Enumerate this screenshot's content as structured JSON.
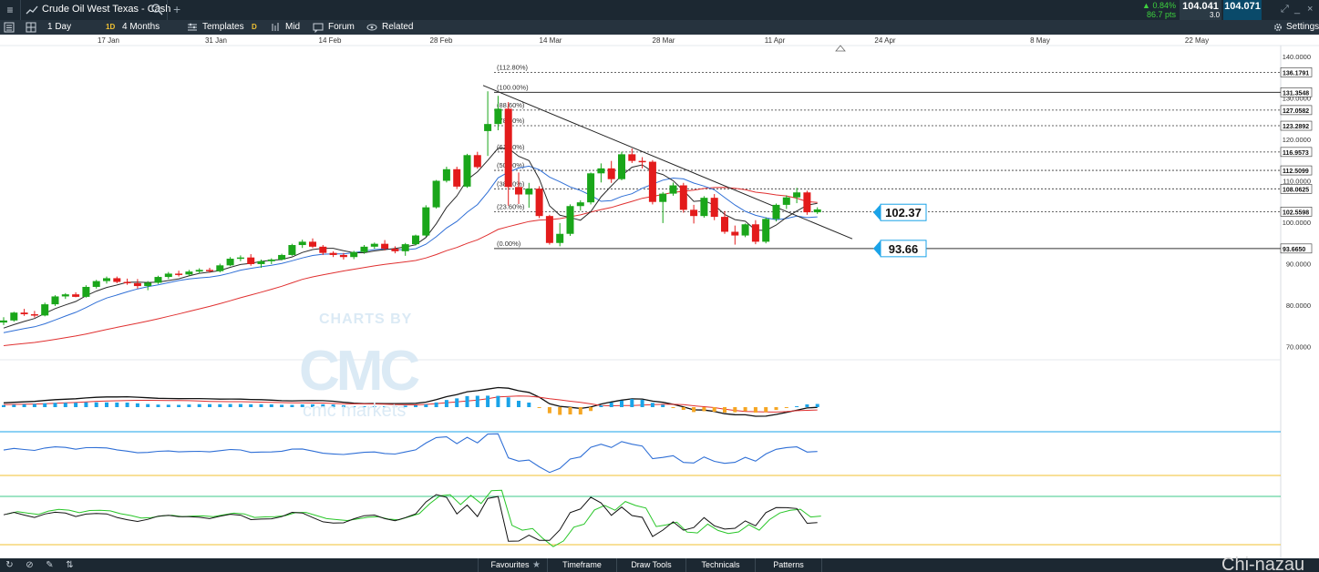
{
  "titlebar": {
    "instrument": "Crude Oil West Texas - Cash",
    "change_pct": "0.84%",
    "change_pts": "86.7 pts",
    "bid": "104.041",
    "spread": "3.0",
    "ask": "104.071"
  },
  "toolbar": {
    "interval": "1 Day",
    "badge_1d": "1D",
    "range": "4 Months",
    "templates": "Templates",
    "badge_d": "D",
    "price_type": "Mid",
    "forum": "Forum",
    "related": "Related",
    "settings": "Settings"
  },
  "watermark": {
    "line1": "CHARTS BY",
    "line2": "CMC",
    "line3": "cmc markets"
  },
  "bottombar": {
    "tabs": [
      "Favourites",
      "Timeframe",
      "Draw Tools",
      "Technicals",
      "Patterns"
    ],
    "corner_text": "Chi-nazau"
  },
  "colors": {
    "up": "#1aa61a",
    "down": "#e31b1b",
    "ma_short": "#2b2b2b",
    "ma_mid": "#2f6fd6",
    "ma_long": "#e03030",
    "accent": "#1aa3e8"
  },
  "chart_data": {
    "type": "candlestick",
    "x_axis_labels": [
      "17 Jan",
      "31 Jan",
      "14 Feb",
      "28 Feb",
      "14 Mar",
      "28 Mar",
      "11 Apr",
      "24 Apr",
      "8 May",
      "22 May"
    ],
    "y_axis_labels": [
      "140.0000",
      "130.0000",
      "120.0000",
      "110.0000",
      "100.0000",
      "90.0000",
      "80.0000",
      "70.0000"
    ],
    "ylim": [
      62,
      146
    ],
    "fib_levels": [
      {
        "label": "(112.80%)",
        "value": 136.1791,
        "axis_label": "136.1791"
      },
      {
        "label": "(100.00%)",
        "value": 131.3548,
        "axis_label": "131.3548"
      },
      {
        "label": "(88.60%)",
        "value": 127.0582,
        "axis_label": "127.0582"
      },
      {
        "label": "(78.60%)",
        "value": 123.2892,
        "axis_label": "123.2892"
      },
      {
        "label": "(61.80%)",
        "value": 116.9573,
        "axis_label": "116.9573"
      },
      {
        "label": "(50.00%)",
        "value": 112.5099,
        "axis_label": "112.5099"
      },
      {
        "label": "(38.20%)",
        "value": 108.0625,
        "axis_label": "108.0625"
      },
      {
        "label": "(23.60%)",
        "value": 102.5598,
        "axis_label": "102.5598"
      },
      {
        "label": "(0.00%)",
        "value": 93.665,
        "axis_label": "93.6650"
      }
    ],
    "callouts": [
      {
        "text": "102.37",
        "value": 102.37
      },
      {
        "text": "93.66",
        "value": 93.66
      }
    ],
    "candles": [
      [
        75.8,
        77.1,
        75.2,
        76.3
      ],
      [
        76.3,
        78.4,
        76.0,
        78.2
      ],
      [
        78.2,
        79.1,
        77.4,
        77.8
      ],
      [
        77.8,
        78.6,
        77.0,
        77.5
      ],
      [
        77.5,
        80.6,
        77.3,
        80.2
      ],
      [
        80.2,
        82.4,
        79.8,
        82.1
      ],
      [
        82.1,
        82.9,
        81.5,
        82.6
      ],
      [
        82.6,
        83.1,
        81.9,
        82.0
      ],
      [
        82.0,
        84.8,
        81.8,
        84.4
      ],
      [
        84.4,
        86.1,
        84.0,
        85.8
      ],
      [
        85.8,
        86.9,
        85.2,
        86.5
      ],
      [
        86.5,
        86.9,
        85.3,
        85.6
      ],
      [
        85.6,
        86.4,
        84.9,
        85.3
      ],
      [
        85.3,
        86.3,
        84.0,
        84.6
      ],
      [
        84.6,
        85.8,
        83.6,
        85.4
      ],
      [
        85.4,
        87.1,
        85.1,
        86.8
      ],
      [
        86.8,
        88.0,
        86.3,
        87.6
      ],
      [
        87.6,
        88.3,
        86.9,
        87.4
      ],
      [
        87.4,
        88.5,
        87.0,
        88.1
      ],
      [
        88.1,
        88.9,
        87.6,
        88.5
      ],
      [
        88.5,
        89.0,
        87.8,
        88.2
      ],
      [
        88.2,
        90.0,
        87.9,
        89.6
      ],
      [
        89.6,
        91.6,
        89.4,
        91.2
      ],
      [
        91.2,
        92.0,
        90.6,
        91.5
      ],
      [
        91.5,
        92.3,
        89.5,
        89.9
      ],
      [
        89.9,
        91.0,
        89.0,
        90.6
      ],
      [
        90.6,
        91.3,
        89.9,
        91.0
      ],
      [
        91.0,
        92.4,
        90.8,
        92.1
      ],
      [
        92.1,
        94.8,
        91.9,
        94.5
      ],
      [
        94.5,
        95.8,
        93.8,
        95.3
      ],
      [
        95.3,
        96.1,
        93.8,
        94.1
      ],
      [
        94.1,
        94.5,
        92.1,
        92.6
      ],
      [
        92.6,
        93.0,
        91.6,
        92.1
      ],
      [
        92.1,
        92.6,
        91.0,
        91.6
      ],
      [
        91.6,
        93.1,
        91.1,
        92.8
      ],
      [
        92.8,
        94.5,
        92.4,
        94.1
      ],
      [
        94.1,
        95.1,
        93.6,
        94.8
      ],
      [
        94.8,
        95.7,
        93.2,
        93.6
      ],
      [
        93.6,
        94.2,
        92.5,
        93.0
      ],
      [
        93.0,
        95.0,
        91.9,
        94.7
      ],
      [
        94.7,
        97.0,
        94.4,
        96.8
      ],
      [
        96.8,
        104.1,
        96.5,
        103.6
      ],
      [
        103.6,
        110.2,
        103.3,
        110.0
      ],
      [
        110.0,
        113.4,
        109.6,
        112.8
      ],
      [
        112.8,
        113.4,
        108.0,
        108.6
      ],
      [
        108.6,
        116.5,
        108.3,
        116.2
      ],
      [
        116.2,
        117.0,
        112.9,
        113.3
      ],
      [
        122.0,
        131.6,
        116.0,
        123.7
      ],
      [
        123.7,
        130.5,
        122.2,
        127.4
      ],
      [
        127.4,
        129.0,
        104.0,
        108.5
      ],
      [
        108.5,
        112.0,
        104.4,
        106.7
      ],
      [
        106.7,
        109.5,
        103.5,
        108.1
      ],
      [
        108.1,
        108.7,
        101.0,
        101.5
      ],
      [
        101.5,
        101.8,
        94.6,
        95.0
      ],
      [
        95.0,
        99.8,
        94.2,
        97.2
      ],
      [
        97.2,
        104.3,
        96.7,
        103.9
      ],
      [
        103.9,
        105.3,
        102.8,
        104.8
      ],
      [
        104.8,
        112.0,
        104.3,
        111.8
      ],
      [
        111.8,
        114.2,
        109.6,
        113.0
      ],
      [
        113.0,
        114.8,
        109.5,
        110.4
      ],
      [
        110.4,
        117.0,
        110.1,
        116.4
      ],
      [
        116.4,
        117.8,
        114.3,
        114.8
      ],
      [
        114.8,
        115.7,
        113.0,
        114.6
      ],
      [
        114.6,
        115.0,
        104.3,
        104.9
      ],
      [
        104.9,
        107.3,
        99.8,
        106.9
      ],
      [
        106.9,
        109.6,
        106.4,
        108.9
      ],
      [
        108.9,
        109.5,
        102.3,
        103.0
      ],
      [
        103.0,
        104.2,
        99.7,
        101.5
      ],
      [
        101.5,
        106.3,
        101.1,
        105.9
      ],
      [
        105.9,
        106.8,
        100.5,
        101.3
      ],
      [
        101.3,
        102.7,
        97.2,
        97.7
      ],
      [
        97.7,
        99.2,
        94.6,
        96.8
      ],
      [
        96.8,
        99.7,
        96.4,
        99.5
      ],
      [
        99.5,
        100.5,
        94.7,
        95.3
      ],
      [
        95.3,
        101.2,
        94.9,
        100.8
      ],
      [
        100.8,
        104.5,
        100.2,
        104.2
      ],
      [
        104.2,
        106.5,
        103.2,
        106.0
      ],
      [
        106.0,
        108.3,
        104.6,
        107.2
      ],
      [
        107.2,
        107.6,
        101.8,
        102.4
      ],
      [
        102.4,
        103.6,
        102.0,
        103.1
      ]
    ]
  }
}
